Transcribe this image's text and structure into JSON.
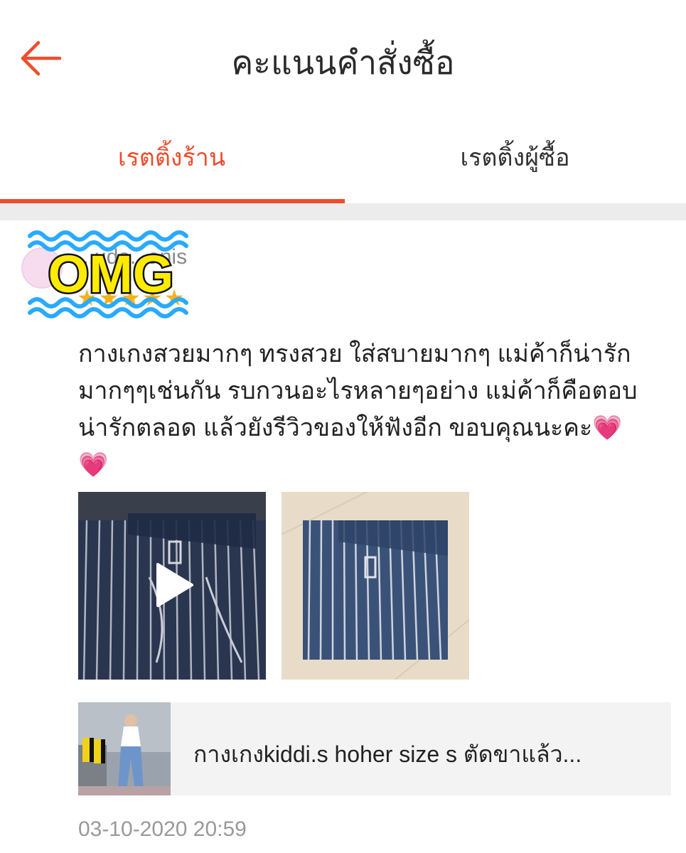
{
  "header": {
    "title": "คะแนนคำสั่งซื้อ",
    "back_icon": "arrow-left-icon"
  },
  "tabs": [
    {
      "label": "เรตติ้งร้าน",
      "active": true
    },
    {
      "label": "เรตติ้งผู้ซื้อ",
      "active": false
    }
  ],
  "colors": {
    "accent": "#ee4d2d",
    "star": "#f6b21b",
    "overlay_yellow": "#ffeb00",
    "overlay_wave": "#29aaff"
  },
  "review": {
    "username": "...ude...anis",
    "rating": 5,
    "stars": "★★★★★",
    "lines": [
      "กางเกงสวยมากๆ ทรงสวย ใส่สบายมากๆ แม่ค้าก็น่ารัก",
      "มากๆๆเช่นกัน รบกวนอะไรหลายๆอย่าง แม่ค้าก็คือตอบ",
      "น่ารักตลอด แล้วยังรีวิวของให้ฟังอีก ขอบคุณนะคะ"
    ],
    "heart": "💗",
    "timestamp": "03-10-2020 20:59"
  },
  "overlay": {
    "text": "OMG"
  },
  "product": {
    "name": "กางเกงkiddi.s hoher size s ตัดขาแล้ว..."
  }
}
